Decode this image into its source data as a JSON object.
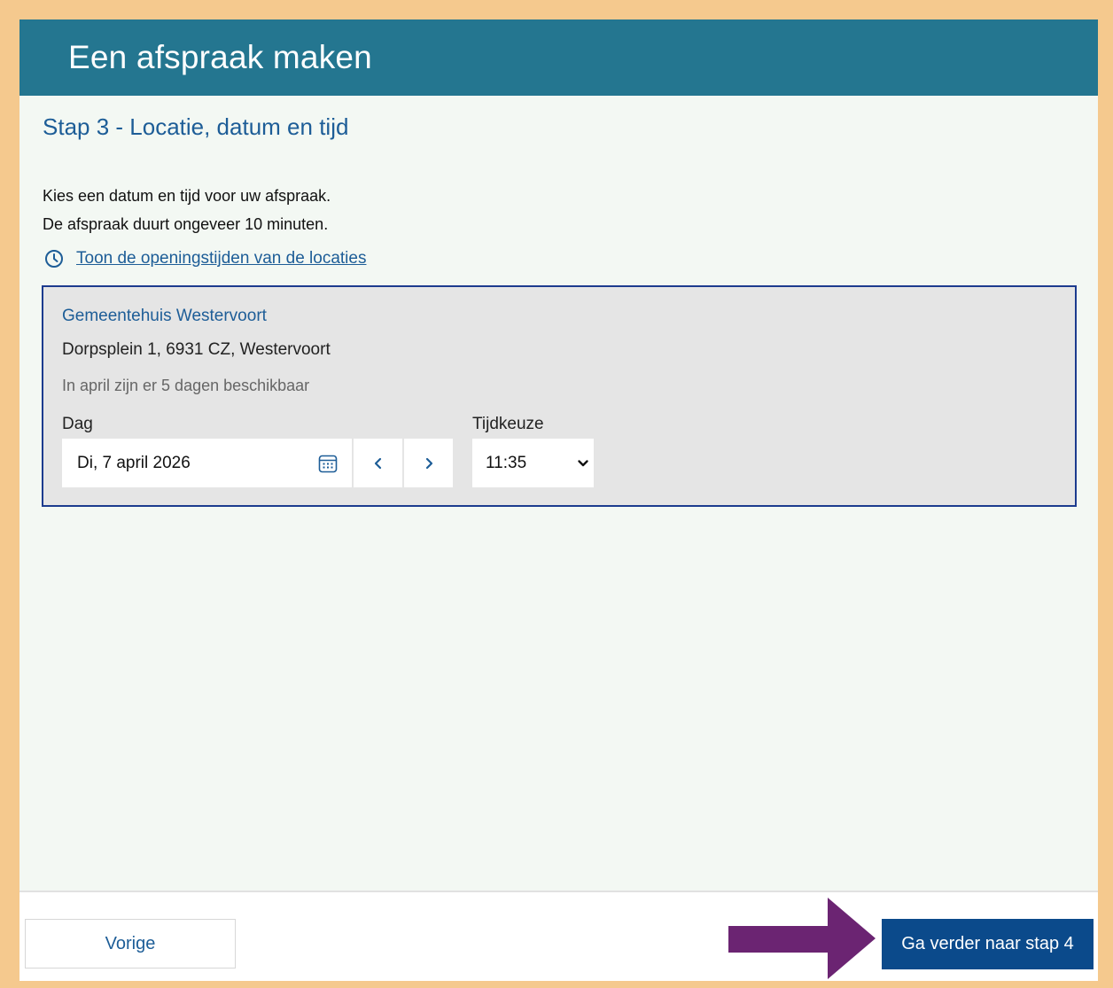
{
  "header": {
    "title": "Een afspraak maken"
  },
  "step": {
    "title": "Stap 3 - Locatie, datum en tijd"
  },
  "intro": {
    "line1": "Kies een datum en tijd voor uw afspraak.",
    "line2": "De afspraak duurt ongeveer 10 minuten."
  },
  "opening_hours_link": {
    "label": "Toon de openingstijden van de locaties",
    "icon": "clock-icon"
  },
  "location": {
    "name": "Gemeentehuis Westervoort",
    "address": "Dorpsplein 1, 6931 CZ, Westervoort",
    "availability": "In april zijn er 5 dagen beschikbaar",
    "day_label": "Dag",
    "day_value": "Di, 7 april 2026",
    "time_label": "Tijdkeuze",
    "time_value": "11:35"
  },
  "footer": {
    "prev_label": "Vorige",
    "next_label": "Ga verder naar stap 4"
  },
  "colors": {
    "header_bg": "#247690",
    "accent_blue": "#1d5d97",
    "primary_button": "#0b4a8b",
    "annotation_arrow": "#6b2472",
    "outer_border": "#f5c98e"
  }
}
